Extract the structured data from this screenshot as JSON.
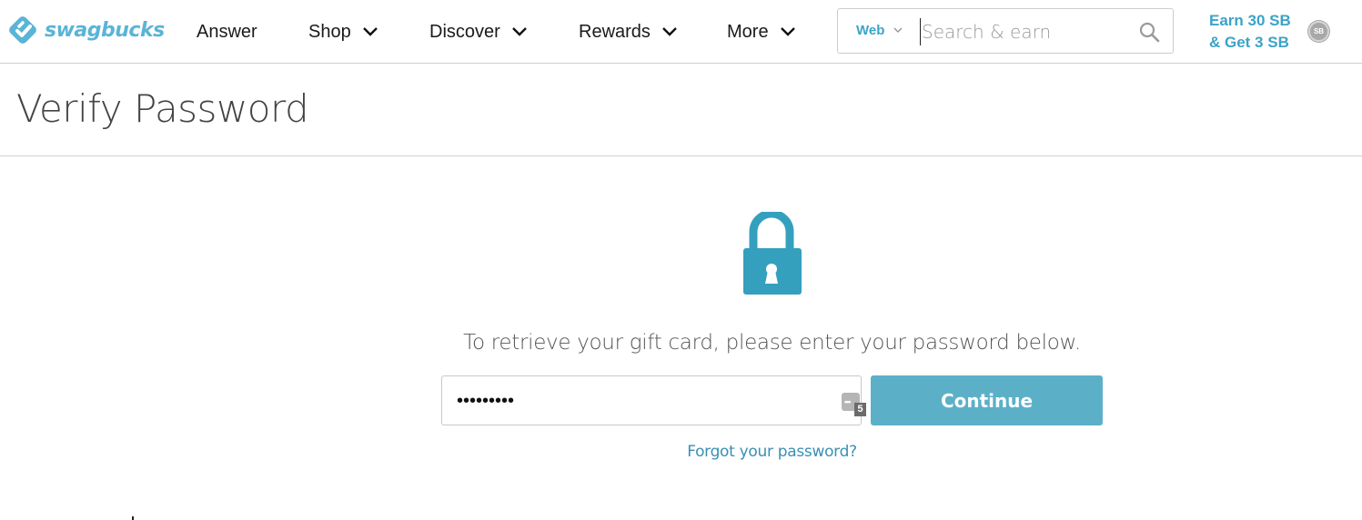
{
  "header": {
    "logo_text": "swagbucks",
    "nav": [
      {
        "label": "Answer",
        "has_dropdown": false
      },
      {
        "label": "Shop",
        "has_dropdown": true
      },
      {
        "label": "Discover",
        "has_dropdown": true
      },
      {
        "label": "Rewards",
        "has_dropdown": true
      },
      {
        "label": "More",
        "has_dropdown": true
      }
    ],
    "search": {
      "scope": "Web",
      "placeholder": "Search & earn",
      "value": ""
    },
    "promo": {
      "line1": "Earn 30 SB",
      "line2": "& Get 3 SB"
    },
    "sb_badge": "SB"
  },
  "page": {
    "title": "Verify Password"
  },
  "verify": {
    "lock_icon": "lock-icon",
    "instructions": "To retrieve your gift card, please enter your password below.",
    "password_value": "•••••••••",
    "password_manager_count": "5",
    "continue_label": "Continue",
    "forgot_label": "Forgot your password?"
  },
  "colors": {
    "brand": "#5ab4d6",
    "accent": "#3ba3c7",
    "button": "#5bb0c8",
    "lock": "#34a0be",
    "link": "#3a8fb5"
  }
}
